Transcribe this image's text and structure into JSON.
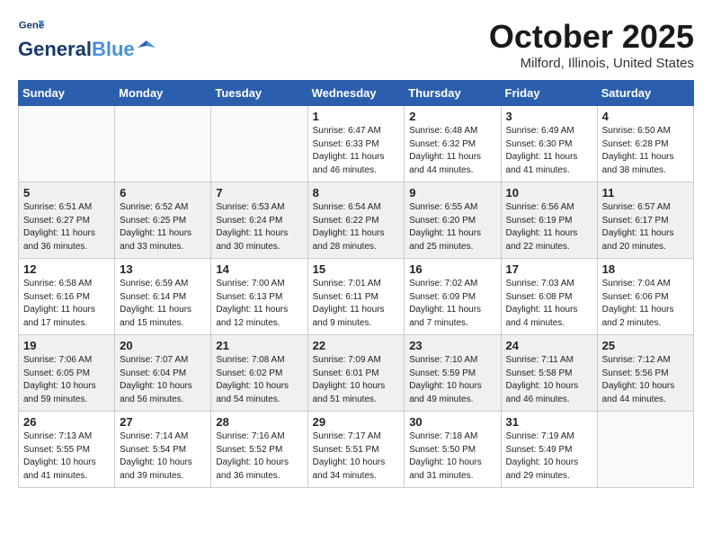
{
  "header": {
    "logo_line1": "General",
    "logo_line2": "Blue",
    "month": "October 2025",
    "location": "Milford, Illinois, United States"
  },
  "weekdays": [
    "Sunday",
    "Monday",
    "Tuesday",
    "Wednesday",
    "Thursday",
    "Friday",
    "Saturday"
  ],
  "rows": [
    [
      {
        "day": "",
        "info": ""
      },
      {
        "day": "",
        "info": ""
      },
      {
        "day": "",
        "info": ""
      },
      {
        "day": "1",
        "info": "Sunrise: 6:47 AM\nSunset: 6:33 PM\nDaylight: 11 hours and 46 minutes."
      },
      {
        "day": "2",
        "info": "Sunrise: 6:48 AM\nSunset: 6:32 PM\nDaylight: 11 hours and 44 minutes."
      },
      {
        "day": "3",
        "info": "Sunrise: 6:49 AM\nSunset: 6:30 PM\nDaylight: 11 hours and 41 minutes."
      },
      {
        "day": "4",
        "info": "Sunrise: 6:50 AM\nSunset: 6:28 PM\nDaylight: 11 hours and 38 minutes."
      }
    ],
    [
      {
        "day": "5",
        "info": "Sunrise: 6:51 AM\nSunset: 6:27 PM\nDaylight: 11 hours and 36 minutes."
      },
      {
        "day": "6",
        "info": "Sunrise: 6:52 AM\nSunset: 6:25 PM\nDaylight: 11 hours and 33 minutes."
      },
      {
        "day": "7",
        "info": "Sunrise: 6:53 AM\nSunset: 6:24 PM\nDaylight: 11 hours and 30 minutes."
      },
      {
        "day": "8",
        "info": "Sunrise: 6:54 AM\nSunset: 6:22 PM\nDaylight: 11 hours and 28 minutes."
      },
      {
        "day": "9",
        "info": "Sunrise: 6:55 AM\nSunset: 6:20 PM\nDaylight: 11 hours and 25 minutes."
      },
      {
        "day": "10",
        "info": "Sunrise: 6:56 AM\nSunset: 6:19 PM\nDaylight: 11 hours and 22 minutes."
      },
      {
        "day": "11",
        "info": "Sunrise: 6:57 AM\nSunset: 6:17 PM\nDaylight: 11 hours and 20 minutes."
      }
    ],
    [
      {
        "day": "12",
        "info": "Sunrise: 6:58 AM\nSunset: 6:16 PM\nDaylight: 11 hours and 17 minutes."
      },
      {
        "day": "13",
        "info": "Sunrise: 6:59 AM\nSunset: 6:14 PM\nDaylight: 11 hours and 15 minutes."
      },
      {
        "day": "14",
        "info": "Sunrise: 7:00 AM\nSunset: 6:13 PM\nDaylight: 11 hours and 12 minutes."
      },
      {
        "day": "15",
        "info": "Sunrise: 7:01 AM\nSunset: 6:11 PM\nDaylight: 11 hours and 9 minutes."
      },
      {
        "day": "16",
        "info": "Sunrise: 7:02 AM\nSunset: 6:09 PM\nDaylight: 11 hours and 7 minutes."
      },
      {
        "day": "17",
        "info": "Sunrise: 7:03 AM\nSunset: 6:08 PM\nDaylight: 11 hours and 4 minutes."
      },
      {
        "day": "18",
        "info": "Sunrise: 7:04 AM\nSunset: 6:06 PM\nDaylight: 11 hours and 2 minutes."
      }
    ],
    [
      {
        "day": "19",
        "info": "Sunrise: 7:06 AM\nSunset: 6:05 PM\nDaylight: 10 hours and 59 minutes."
      },
      {
        "day": "20",
        "info": "Sunrise: 7:07 AM\nSunset: 6:04 PM\nDaylight: 10 hours and 56 minutes."
      },
      {
        "day": "21",
        "info": "Sunrise: 7:08 AM\nSunset: 6:02 PM\nDaylight: 10 hours and 54 minutes."
      },
      {
        "day": "22",
        "info": "Sunrise: 7:09 AM\nSunset: 6:01 PM\nDaylight: 10 hours and 51 minutes."
      },
      {
        "day": "23",
        "info": "Sunrise: 7:10 AM\nSunset: 5:59 PM\nDaylight: 10 hours and 49 minutes."
      },
      {
        "day": "24",
        "info": "Sunrise: 7:11 AM\nSunset: 5:58 PM\nDaylight: 10 hours and 46 minutes."
      },
      {
        "day": "25",
        "info": "Sunrise: 7:12 AM\nSunset: 5:56 PM\nDaylight: 10 hours and 44 minutes."
      }
    ],
    [
      {
        "day": "26",
        "info": "Sunrise: 7:13 AM\nSunset: 5:55 PM\nDaylight: 10 hours and 41 minutes."
      },
      {
        "day": "27",
        "info": "Sunrise: 7:14 AM\nSunset: 5:54 PM\nDaylight: 10 hours and 39 minutes."
      },
      {
        "day": "28",
        "info": "Sunrise: 7:16 AM\nSunset: 5:52 PM\nDaylight: 10 hours and 36 minutes."
      },
      {
        "day": "29",
        "info": "Sunrise: 7:17 AM\nSunset: 5:51 PM\nDaylight: 10 hours and 34 minutes."
      },
      {
        "day": "30",
        "info": "Sunrise: 7:18 AM\nSunset: 5:50 PM\nDaylight: 10 hours and 31 minutes."
      },
      {
        "day": "31",
        "info": "Sunrise: 7:19 AM\nSunset: 5:49 PM\nDaylight: 10 hours and 29 minutes."
      },
      {
        "day": "",
        "info": ""
      }
    ]
  ]
}
